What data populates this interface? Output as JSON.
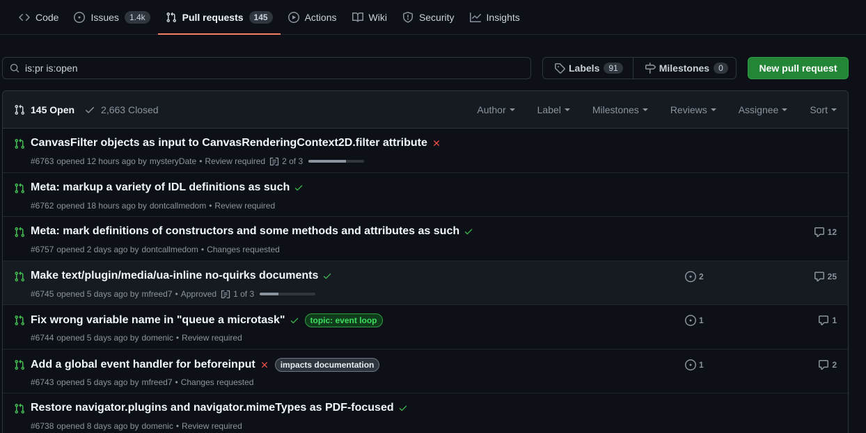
{
  "tabs": [
    {
      "label": "Code",
      "icon": "code-icon",
      "count": ""
    },
    {
      "label": "Issues",
      "icon": "issue-opened-icon",
      "count": "1.4k"
    },
    {
      "label": "Pull requests",
      "icon": "git-pull-request-icon",
      "count": "145"
    },
    {
      "label": "Actions",
      "icon": "play-icon",
      "count": ""
    },
    {
      "label": "Wiki",
      "icon": "book-icon",
      "count": ""
    },
    {
      "label": "Security",
      "icon": "shield-icon",
      "count": ""
    },
    {
      "label": "Insights",
      "icon": "graph-icon",
      "count": ""
    }
  ],
  "search": {
    "value": "is:pr is:open"
  },
  "labels_button": {
    "label": "Labels",
    "count": "91"
  },
  "milestones_button": {
    "label": "Milestones",
    "count": "0"
  },
  "new_pr_button": {
    "label": "New pull request"
  },
  "header": {
    "open_label": "145 Open",
    "closed_label": "2,663 Closed",
    "filters": [
      "Author",
      "Label",
      "Milestones",
      "Reviews",
      "Assignee",
      "Sort"
    ]
  },
  "pulls": [
    {
      "title": "CanvasFilter objects as input to CanvasRenderingContext2D.filter attribute",
      "status": "fail",
      "number": "#6763",
      "opened": "opened 12 hours ago by",
      "author": "mysteryDate",
      "review": "Review required",
      "tasks": "2 of 3",
      "progress": 0.67,
      "labels": [],
      "linked_issues": "",
      "comments": ""
    },
    {
      "title": "Meta: markup a variety of IDL definitions as such",
      "status": "ok",
      "number": "#6762",
      "opened": "opened 18 hours ago by",
      "author": "dontcallmedom",
      "review": "Review required",
      "tasks": "",
      "labels": [],
      "linked_issues": "",
      "comments": ""
    },
    {
      "title": "Meta: mark definitions of constructors and some methods and attributes as such",
      "status": "ok",
      "number": "#6757",
      "opened": "opened 2 days ago by",
      "author": "dontcallmedom",
      "review": "Changes requested",
      "tasks": "",
      "labels": [],
      "linked_issues": "",
      "comments": "12"
    },
    {
      "title": "Make text/plugin/media/ua-inline no-quirks documents",
      "status": "ok",
      "number": "#6745",
      "opened": "opened 5 days ago by",
      "author": "mfreed7",
      "review": "Approved",
      "tasks": "1 of 3",
      "progress": 0.33,
      "labels": [],
      "linked_issues": "2",
      "comments": "25"
    },
    {
      "title": "Fix wrong variable name in \"queue a microtask\"",
      "status": "ok",
      "number": "#6744",
      "opened": "opened 5 days ago by",
      "author": "domenic",
      "review": "Review required",
      "tasks": "",
      "labels": [
        {
          "text": "topic: event loop",
          "style": "green"
        }
      ],
      "linked_issues": "1",
      "comments": "1"
    },
    {
      "title": "Add a global event handler for beforeinput",
      "status": "fail",
      "number": "#6743",
      "opened": "opened 5 days ago by",
      "author": "mfreed7",
      "review": "Changes requested",
      "tasks": "",
      "labels": [
        {
          "text": "impacts documentation",
          "style": "grey"
        }
      ],
      "linked_issues": "1",
      "comments": "2"
    },
    {
      "title": "Restore navigator.plugins and navigator.mimeTypes as PDF-focused",
      "status": "ok",
      "number": "#6738",
      "opened": "opened 8 days ago by",
      "author": "domenic",
      "review": "Review required",
      "tasks": "",
      "labels": [],
      "linked_issues": "",
      "comments": ""
    }
  ]
}
